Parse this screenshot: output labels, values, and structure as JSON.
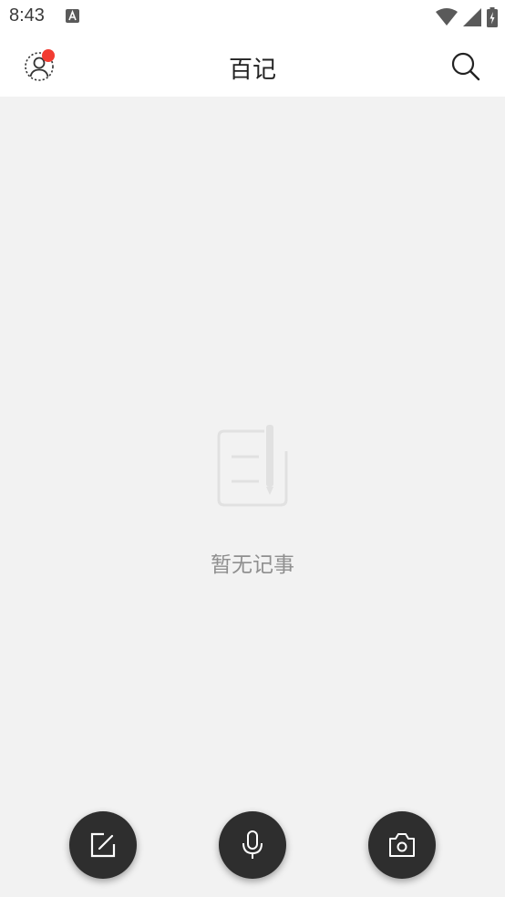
{
  "status_bar": {
    "time": "8:43",
    "icons": [
      "a-notification-icon",
      "wifi-icon",
      "cell-signal-icon",
      "battery-charging-icon"
    ]
  },
  "header": {
    "title": "百记",
    "left_icon": "profile-icon",
    "right_icon": "search-icon",
    "notification_dot_color": "#f23c32"
  },
  "empty_state": {
    "icon": "notebook-pen-icon",
    "message": "暂无记事"
  },
  "fabs": [
    {
      "icon": "edit-note-icon"
    },
    {
      "icon": "microphone-icon"
    },
    {
      "icon": "camera-icon"
    }
  ],
  "colors": {
    "background": "#f2f2f2",
    "header_background": "#ffffff",
    "fab_background": "#2e2e2e",
    "accent_red": "#f23c32"
  }
}
